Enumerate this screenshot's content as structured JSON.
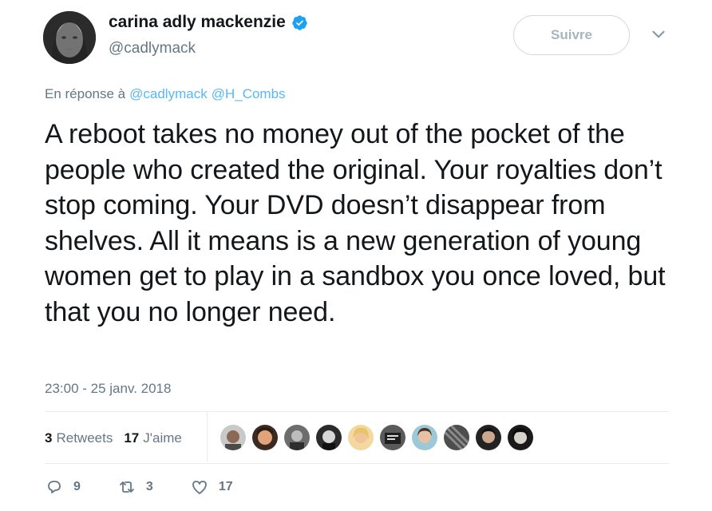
{
  "author": {
    "display_name": "carina adly mackenzie",
    "handle": "@cadlymack",
    "verified": true
  },
  "follow_button": {
    "label": "Suivre"
  },
  "reply_context": {
    "prefix": "En réponse à",
    "handles": [
      "@cadlymack",
      "@H_Combs"
    ]
  },
  "tweet": {
    "text": "A reboot takes no money out of the pocket of the people who created the original. Your royalties don’t stop coming. Your DVD doesn’t disappear from shelves. All it means is a new generation of young women get to play in a sandbox you once loved, but that you no longer need.",
    "timestamp": "23:00 - 25 janv. 2018"
  },
  "stats": {
    "retweets_count": "3",
    "retweets_label": "Retweets",
    "likes_count": "17",
    "likes_label": "J'aime"
  },
  "liker_avatars": [
    "avatar-1",
    "avatar-2",
    "avatar-3",
    "avatar-4",
    "avatar-5",
    "avatar-6",
    "avatar-7",
    "avatar-8",
    "avatar-9"
  ],
  "actions": {
    "reply_count": "9",
    "retweet_count": "3",
    "like_count": "17"
  },
  "colors": {
    "link": "#1da1f2",
    "secondary_text": "#657786",
    "verified": "#1da1f2"
  }
}
